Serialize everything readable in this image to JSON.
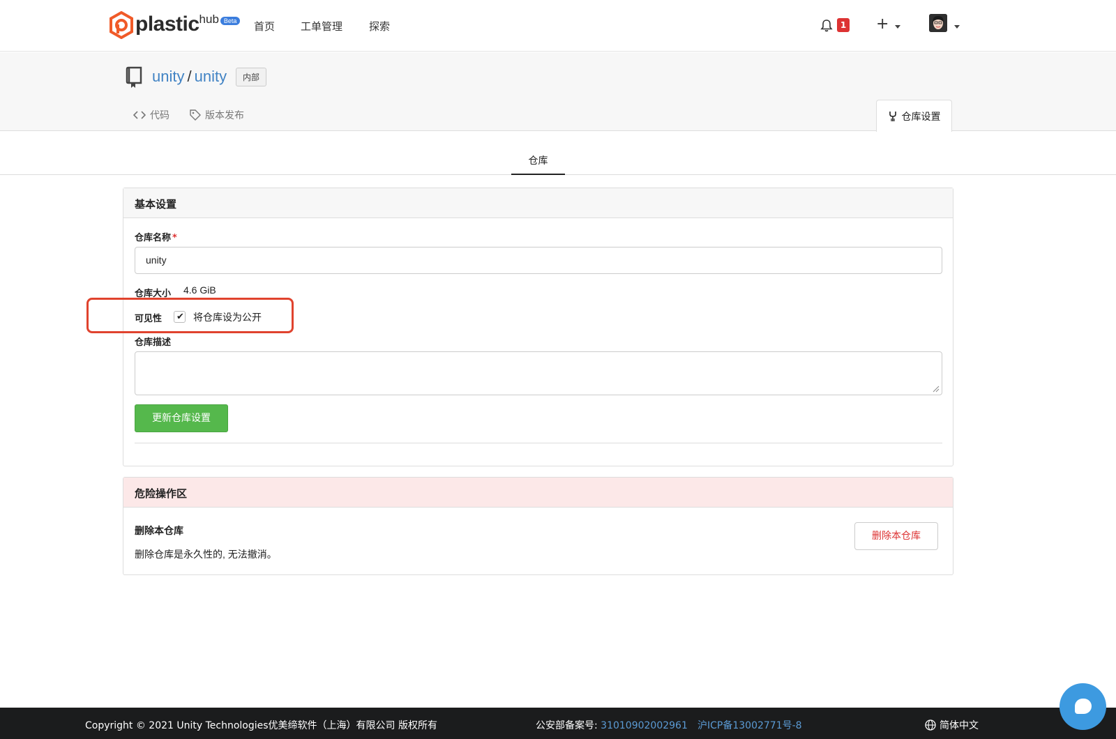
{
  "nav": {
    "logo_text": "plastic",
    "logo_sub": "hub",
    "beta": "Beta",
    "links": [
      "首页",
      "工单管理",
      "探索"
    ],
    "notification_count": "1",
    "plus": "+"
  },
  "repo": {
    "owner": "unity",
    "separator": "/",
    "name": "unity",
    "visibility_tag": "内部",
    "tabs": [
      "代码",
      "版本发布"
    ],
    "active_tab": "仓库设置"
  },
  "subtab": "仓库",
  "basic": {
    "header": "基本设置",
    "name_label": "仓库名称",
    "required_mark": "*",
    "name_value": "unity",
    "size_label": "仓库大小",
    "size_value": "4.6 GiB",
    "visibility_label": "可见性",
    "visibility_checked": true,
    "visibility_option": "将仓库设为公开",
    "desc_label": "仓库描述",
    "desc_value": "",
    "update_button": "更新仓库设置"
  },
  "danger": {
    "header": "危险操作区",
    "title": "删除本仓库",
    "description": "删除仓库是永久性的, 无法撤消。",
    "delete_button": "删除本仓库"
  },
  "footer": {
    "copyright": "Copyright © 2021 Unity Technologies优美缔软件（上海）有限公司 版权所有",
    "record_label": "公安部备案号: ",
    "record_number": "31010902002961",
    "icp": "沪ICP备13002771号-8",
    "language": "简体中文"
  },
  "colors": {
    "accent": "#4183c4",
    "primary_button": "#55b84c",
    "danger": "#dd3333",
    "highlight_box": "#e0432e",
    "footer_bg": "#1b1c1d",
    "chat_button": "#3d9ae0"
  }
}
